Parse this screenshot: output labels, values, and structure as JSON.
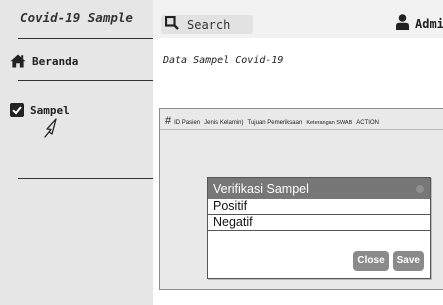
{
  "app": {
    "brand": "Covid-19 Sample"
  },
  "sidebar": {
    "items": [
      {
        "label": "Beranda",
        "icon": "home-icon"
      },
      {
        "label": "Sampel",
        "icon": "checkbox-checked-icon"
      }
    ]
  },
  "header": {
    "search": {
      "label": "Search",
      "icon": "search-icon"
    },
    "user": {
      "label": "Admin",
      "icon": "user-icon"
    }
  },
  "main": {
    "title": "Data Sampel Covid-19",
    "table": {
      "hash": "#",
      "columns": [
        "ID Pasien",
        "Jenis Kelamin)",
        "Tujuan Pemeriksaan",
        "Keterangan SWAB",
        "ACTION"
      ]
    }
  },
  "modal": {
    "title": "Verifikasi Sampel",
    "options": [
      "Positif",
      "Negatif"
    ],
    "close_label": "Close",
    "save_label": "Save"
  },
  "colors": {
    "sidebar_bg": "#e6e6e6",
    "header_bg": "#f2f2f2",
    "panel_bg": "#e9e9e9",
    "modal_header": "#777777",
    "button_bg": "#8a8a8a"
  }
}
